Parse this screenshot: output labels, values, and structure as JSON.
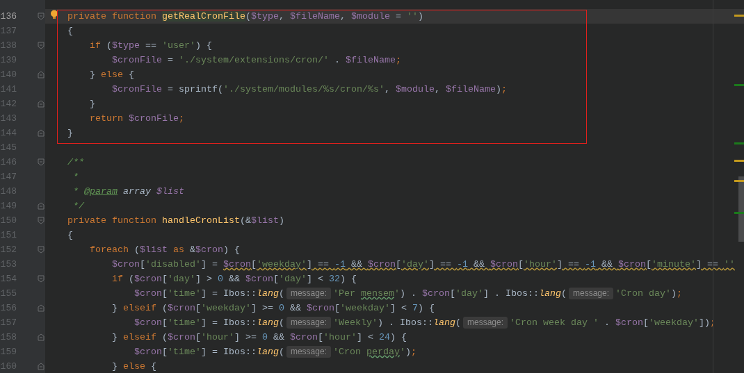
{
  "editor": {
    "lines": [
      {
        "number": "136",
        "kind": "opener",
        "bulb": true,
        "current": true,
        "tokens": [
          {
            "kind": "keyword",
            "text": "    private function "
          },
          {
            "kind": "function",
            "text": "getRealCronFile",
            "match": true
          },
          {
            "kind": "plain",
            "text": "("
          },
          {
            "kind": "variable",
            "text": "$type"
          },
          {
            "kind": "plain",
            "text": ", "
          },
          {
            "kind": "variable",
            "text": "$fileName"
          },
          {
            "kind": "plain",
            "text": ", "
          },
          {
            "kind": "variable",
            "text": "$module"
          },
          {
            "kind": "plain",
            "text": " = "
          },
          {
            "kind": "string",
            "text": "''"
          },
          {
            "kind": "plain",
            "text": ")"
          }
        ]
      },
      {
        "number": "137",
        "kind": "plain",
        "bulb": false,
        "current": false,
        "tokens": [
          {
            "kind": "plain",
            "text": "    {"
          }
        ]
      },
      {
        "number": "138",
        "kind": "opener",
        "bulb": false,
        "current": false,
        "tokens": [
          {
            "kind": "keyword",
            "text": "        if"
          },
          {
            "kind": "plain",
            "text": " ("
          },
          {
            "kind": "variable",
            "text": "$type"
          },
          {
            "kind": "plain",
            "text": " == "
          },
          {
            "kind": "string",
            "text": "'user'"
          },
          {
            "kind": "plain",
            "text": ") {"
          }
        ]
      },
      {
        "number": "139",
        "kind": "plain",
        "bulb": false,
        "current": false,
        "tokens": [
          {
            "kind": "variable",
            "text": "            $cronFile"
          },
          {
            "kind": "plain",
            "text": " = "
          },
          {
            "kind": "string",
            "text": "'./system/extensions/cron/'"
          },
          {
            "kind": "plain",
            "text": " . "
          },
          {
            "kind": "variable",
            "text": "$fileName"
          },
          {
            "kind": "keyword",
            "text": ";"
          }
        ]
      },
      {
        "number": "140",
        "kind": "closer",
        "bulb": false,
        "current": false,
        "tokens": [
          {
            "kind": "plain",
            "text": "        } "
          },
          {
            "kind": "keyword",
            "text": "else"
          },
          {
            "kind": "plain",
            "text": " {"
          }
        ]
      },
      {
        "number": "141",
        "kind": "plain",
        "bulb": false,
        "current": false,
        "tokens": [
          {
            "kind": "variable",
            "text": "            $cronFile"
          },
          {
            "kind": "plain",
            "text": " = sprintf("
          },
          {
            "kind": "string",
            "text": "'./system/modules/%s/cron/%s'"
          },
          {
            "kind": "plain",
            "text": ", "
          },
          {
            "kind": "variable",
            "text": "$module"
          },
          {
            "kind": "plain",
            "text": ", "
          },
          {
            "kind": "variable",
            "text": "$fileName"
          },
          {
            "kind": "plain",
            "text": ")"
          },
          {
            "kind": "keyword",
            "text": ";"
          }
        ]
      },
      {
        "number": "142",
        "kind": "closer",
        "bulb": false,
        "current": false,
        "tokens": [
          {
            "kind": "plain",
            "text": "        }"
          }
        ]
      },
      {
        "number": "143",
        "kind": "plain",
        "bulb": false,
        "current": false,
        "tokens": [
          {
            "kind": "keyword",
            "text": "        return "
          },
          {
            "kind": "variable",
            "text": "$cronFile"
          },
          {
            "kind": "keyword",
            "text": ";"
          }
        ]
      },
      {
        "number": "144",
        "kind": "closer",
        "bulb": false,
        "current": false,
        "tokens": [
          {
            "kind": "plain",
            "text": "    }"
          }
        ]
      },
      {
        "number": "145",
        "kind": "plain",
        "bulb": false,
        "current": false
      },
      {
        "number": "146",
        "kind": "opener",
        "bulb": false,
        "current": false,
        "tokens": [
          {
            "kind": "comment",
            "text": "    /**"
          }
        ]
      },
      {
        "number": "147",
        "kind": "plain",
        "bulb": false,
        "current": false,
        "tokens": [
          {
            "kind": "comment",
            "text": "     *"
          }
        ]
      },
      {
        "number": "148",
        "kind": "plain",
        "bulb": false,
        "current": false,
        "tokens": [
          {
            "kind": "comment",
            "text": "     * "
          },
          {
            "kind": "doctag",
            "text": "@param"
          },
          {
            "kind": "doctype",
            "text": " array "
          },
          {
            "kind": "docvar",
            "text": "$list"
          }
        ]
      },
      {
        "number": "149",
        "kind": "closer",
        "bulb": false,
        "current": false,
        "tokens": [
          {
            "kind": "comment",
            "text": "     */"
          }
        ]
      },
      {
        "number": "150",
        "kind": "opener",
        "bulb": false,
        "current": false,
        "tokens": [
          {
            "kind": "keyword",
            "text": "    private function "
          },
          {
            "kind": "function",
            "text": "handleCronList"
          },
          {
            "kind": "plain",
            "text": "(&"
          },
          {
            "kind": "variable",
            "text": "$list"
          },
          {
            "kind": "plain",
            "text": ")"
          }
        ]
      },
      {
        "number": "151",
        "kind": "plain",
        "bulb": false,
        "current": false,
        "tokens": [
          {
            "kind": "plain",
            "text": "    {"
          }
        ]
      },
      {
        "number": "152",
        "kind": "opener",
        "bulb": false,
        "current": false,
        "tokens": [
          {
            "kind": "keyword",
            "text": "        foreach"
          },
          {
            "kind": "plain",
            "text": " ("
          },
          {
            "kind": "variable",
            "text": "$list"
          },
          {
            "kind": "keyword",
            "text": " as "
          },
          {
            "kind": "plain",
            "text": "&"
          },
          {
            "kind": "variable",
            "text": "$cron"
          },
          {
            "kind": "plain",
            "text": ") {"
          }
        ]
      },
      {
        "number": "153",
        "kind": "plain",
        "bulb": false,
        "current": false,
        "tokens": [
          {
            "kind": "variable",
            "text": "            $cron"
          },
          {
            "kind": "plain",
            "text": "["
          },
          {
            "kind": "string",
            "text": "'disabled'"
          },
          {
            "kind": "plain",
            "text": "] = "
          },
          {
            "kind": "variable",
            "text": "$cron",
            "warning": true
          },
          {
            "kind": "plain",
            "text": "[",
            "warning": true
          },
          {
            "kind": "string",
            "text": "'weekday'",
            "warning": true
          },
          {
            "kind": "plain",
            "text": "] == ",
            "warning": true
          },
          {
            "kind": "number",
            "text": "-1",
            "warning": true
          },
          {
            "kind": "plain",
            "text": " && ",
            "warning": true
          },
          {
            "kind": "variable",
            "text": "$cron",
            "warning": true
          },
          {
            "kind": "plain",
            "text": "[",
            "warning": true
          },
          {
            "kind": "string",
            "text": "'day'",
            "warning": true
          },
          {
            "kind": "plain",
            "text": "] == ",
            "warning": true
          },
          {
            "kind": "number",
            "text": "-1",
            "warning": true
          },
          {
            "kind": "plain",
            "text": " && ",
            "warning": true
          },
          {
            "kind": "variable",
            "text": "$cron",
            "warning": true
          },
          {
            "kind": "plain",
            "text": "[",
            "warning": true
          },
          {
            "kind": "string",
            "text": "'hour'",
            "warning": true
          },
          {
            "kind": "plain",
            "text": "] == ",
            "warning": true
          },
          {
            "kind": "number",
            "text": "-1",
            "warning": true
          },
          {
            "kind": "plain",
            "text": " && ",
            "warning": true
          },
          {
            "kind": "variable",
            "text": "$cron",
            "warning": true
          },
          {
            "kind": "plain",
            "text": "[",
            "warning": true
          },
          {
            "kind": "string",
            "text": "'minute'",
            "warning": true
          },
          {
            "kind": "plain",
            "text": "] == ",
            "warning": true
          },
          {
            "kind": "string",
            "text": "''",
            "warning": true
          }
        ]
      },
      {
        "number": "154",
        "kind": "opener",
        "bulb": false,
        "current": false,
        "tokens": [
          {
            "kind": "keyword",
            "text": "            if"
          },
          {
            "kind": "plain",
            "text": " ("
          },
          {
            "kind": "variable",
            "text": "$cron"
          },
          {
            "kind": "plain",
            "text": "["
          },
          {
            "kind": "string",
            "text": "'day'"
          },
          {
            "kind": "plain",
            "text": "] > "
          },
          {
            "kind": "number",
            "text": "0"
          },
          {
            "kind": "plain",
            "text": " && "
          },
          {
            "kind": "variable",
            "text": "$cron"
          },
          {
            "kind": "plain",
            "text": "["
          },
          {
            "kind": "string",
            "text": "'day'"
          },
          {
            "kind": "plain",
            "text": "] < "
          },
          {
            "kind": "number",
            "text": "32"
          },
          {
            "kind": "plain",
            "text": ") {"
          }
        ]
      },
      {
        "number": "155",
        "kind": "plain",
        "bulb": false,
        "current": false,
        "tokens": [
          {
            "kind": "variable",
            "text": "                $cron"
          },
          {
            "kind": "plain",
            "text": "["
          },
          {
            "kind": "string",
            "text": "'time'"
          },
          {
            "kind": "plain",
            "text": "] = Ibos::"
          },
          {
            "kind": "static",
            "text": "lang"
          },
          {
            "kind": "plain",
            "text": "("
          },
          {
            "kind": "hint",
            "text": "message:"
          },
          {
            "kind": "string",
            "text": "'Per "
          },
          {
            "kind": "string",
            "text": "mensem",
            "typo": true
          },
          {
            "kind": "string",
            "text": "'"
          },
          {
            "kind": "plain",
            "text": ") . "
          },
          {
            "kind": "variable",
            "text": "$cron"
          },
          {
            "kind": "plain",
            "text": "["
          },
          {
            "kind": "string",
            "text": "'day'"
          },
          {
            "kind": "plain",
            "text": "] . Ibos::"
          },
          {
            "kind": "static",
            "text": "lang"
          },
          {
            "kind": "plain",
            "text": "("
          },
          {
            "kind": "hint",
            "text": "message:"
          },
          {
            "kind": "string",
            "text": "'Cron day'"
          },
          {
            "kind": "plain",
            "text": ")"
          },
          {
            "kind": "keyword",
            "text": ";"
          }
        ]
      },
      {
        "number": "156",
        "kind": "closer",
        "bulb": false,
        "current": false,
        "tokens": [
          {
            "kind": "plain",
            "text": "            } "
          },
          {
            "kind": "keyword",
            "text": "elseif"
          },
          {
            "kind": "plain",
            "text": " ("
          },
          {
            "kind": "variable",
            "text": "$cron"
          },
          {
            "kind": "plain",
            "text": "["
          },
          {
            "kind": "string",
            "text": "'weekday'"
          },
          {
            "kind": "plain",
            "text": "] >= "
          },
          {
            "kind": "number",
            "text": "0"
          },
          {
            "kind": "plain",
            "text": " && "
          },
          {
            "kind": "variable",
            "text": "$cron"
          },
          {
            "kind": "plain",
            "text": "["
          },
          {
            "kind": "string",
            "text": "'weekday'"
          },
          {
            "kind": "plain",
            "text": "] < "
          },
          {
            "kind": "number",
            "text": "7"
          },
          {
            "kind": "plain",
            "text": ") {"
          }
        ]
      },
      {
        "number": "157",
        "kind": "plain",
        "bulb": false,
        "current": false,
        "tokens": [
          {
            "kind": "variable",
            "text": "                $cron"
          },
          {
            "kind": "plain",
            "text": "["
          },
          {
            "kind": "string",
            "text": "'time'"
          },
          {
            "kind": "plain",
            "text": "] = Ibos::"
          },
          {
            "kind": "static",
            "text": "lang"
          },
          {
            "kind": "plain",
            "text": "("
          },
          {
            "kind": "hint",
            "text": "message:"
          },
          {
            "kind": "string",
            "text": "'Weekly'"
          },
          {
            "kind": "plain",
            "text": ") . Ibos::"
          },
          {
            "kind": "static",
            "text": "lang"
          },
          {
            "kind": "plain",
            "text": "("
          },
          {
            "kind": "hint",
            "text": "message:"
          },
          {
            "kind": "string",
            "text": "'Cron week day '"
          },
          {
            "kind": "plain",
            "text": " . "
          },
          {
            "kind": "variable",
            "text": "$cron"
          },
          {
            "kind": "plain",
            "text": "["
          },
          {
            "kind": "string",
            "text": "'weekday'"
          },
          {
            "kind": "plain",
            "text": "])"
          },
          {
            "kind": "keyword",
            "text": ";"
          }
        ]
      },
      {
        "number": "158",
        "kind": "closer",
        "bulb": false,
        "current": false,
        "tokens": [
          {
            "kind": "plain",
            "text": "            } "
          },
          {
            "kind": "keyword",
            "text": "elseif"
          },
          {
            "kind": "plain",
            "text": " ("
          },
          {
            "kind": "variable",
            "text": "$cron"
          },
          {
            "kind": "plain",
            "text": "["
          },
          {
            "kind": "string",
            "text": "'hour'"
          },
          {
            "kind": "plain",
            "text": "] >= "
          },
          {
            "kind": "number",
            "text": "0"
          },
          {
            "kind": "plain",
            "text": " && "
          },
          {
            "kind": "variable",
            "text": "$cron"
          },
          {
            "kind": "plain",
            "text": "["
          },
          {
            "kind": "string",
            "text": "'hour'"
          },
          {
            "kind": "plain",
            "text": "] < "
          },
          {
            "kind": "number",
            "text": "24"
          },
          {
            "kind": "plain",
            "text": ") {"
          }
        ]
      },
      {
        "number": "159",
        "kind": "plain",
        "bulb": false,
        "current": false,
        "tokens": [
          {
            "kind": "variable",
            "text": "                $cron"
          },
          {
            "kind": "plain",
            "text": "["
          },
          {
            "kind": "string",
            "text": "'time'"
          },
          {
            "kind": "plain",
            "text": "] = Ibos::"
          },
          {
            "kind": "static",
            "text": "lang"
          },
          {
            "kind": "plain",
            "text": "("
          },
          {
            "kind": "hint",
            "text": "message:"
          },
          {
            "kind": "string",
            "text": "'Cron "
          },
          {
            "kind": "string",
            "text": "perday",
            "typo": true
          },
          {
            "kind": "string",
            "text": "'"
          },
          {
            "kind": "plain",
            "text": ")"
          },
          {
            "kind": "keyword",
            "text": ";"
          }
        ]
      },
      {
        "number": "160",
        "kind": "closer",
        "bulb": false,
        "current": false,
        "tokens": [
          {
            "kind": "plain",
            "text": "            } "
          },
          {
            "kind": "keyword",
            "text": "else"
          },
          {
            "kind": "plain",
            "text": " {"
          }
        ]
      }
    ]
  }
}
